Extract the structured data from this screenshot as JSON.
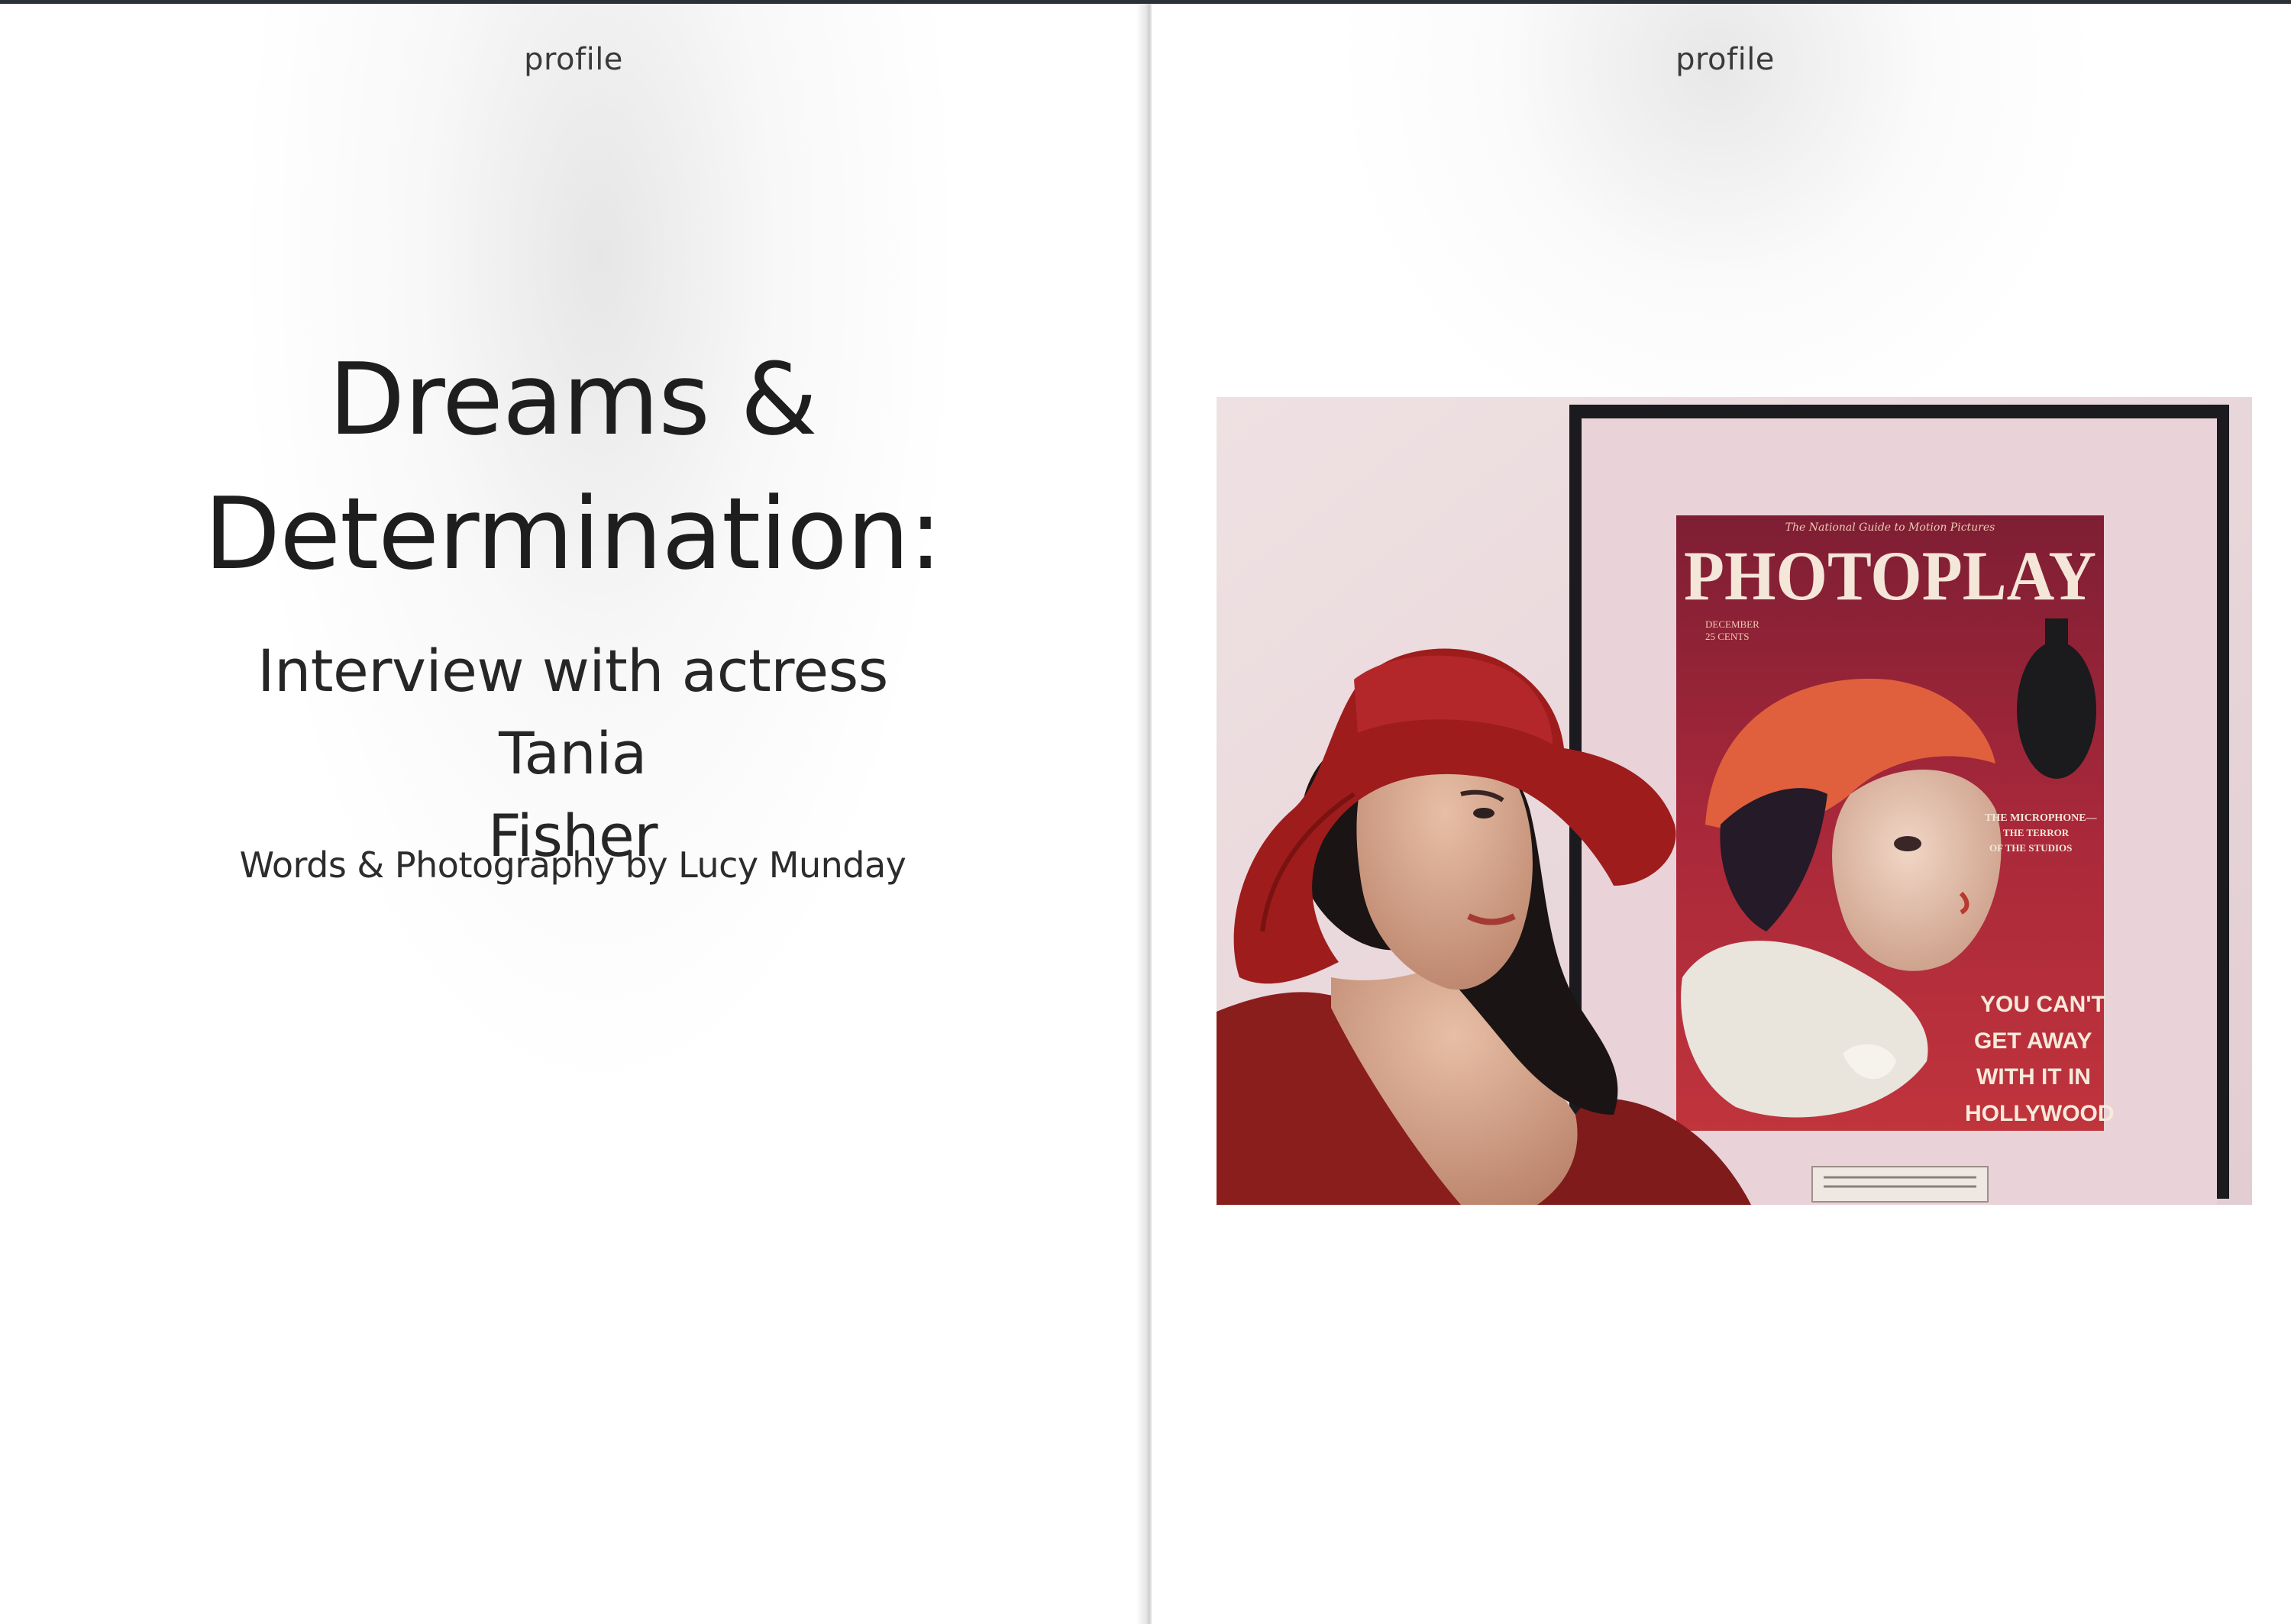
{
  "spread": {
    "left_page": {
      "section_label": "profile",
      "title_line1": "Dreams &",
      "title_line2": "Determination:",
      "subtitle_line1": "Interview with actress Tania",
      "subtitle_line2": "Fisher",
      "byline": "Words & Photography by Lucy Munday"
    },
    "right_page": {
      "section_label": "profile",
      "photo": {
        "poster_masthead": "PHOTOPLAY",
        "poster_tagline": "The National Guide to Motion Pictures",
        "poster_date_line1": "DECEMBER",
        "poster_date_line2": "25 CENTS",
        "poster_blurb_line1": "THE MICROPHONE—",
        "poster_blurb_line2": "THE TERROR",
        "poster_blurb_line3": "OF THE STUDIOS",
        "poster_cover_line1": "YOU CAN'T",
        "poster_cover_line2": "GET AWAY",
        "poster_cover_line3": "WITH IT IN",
        "poster_cover_line4": "HOLLYWOOD"
      }
    }
  },
  "colors": {
    "hat": "#9e1c1c",
    "dress": "#8a1e1c",
    "wall": "#ead9dc",
    "frame": "#1a1a1f",
    "poster_bg": "#8f2232"
  }
}
